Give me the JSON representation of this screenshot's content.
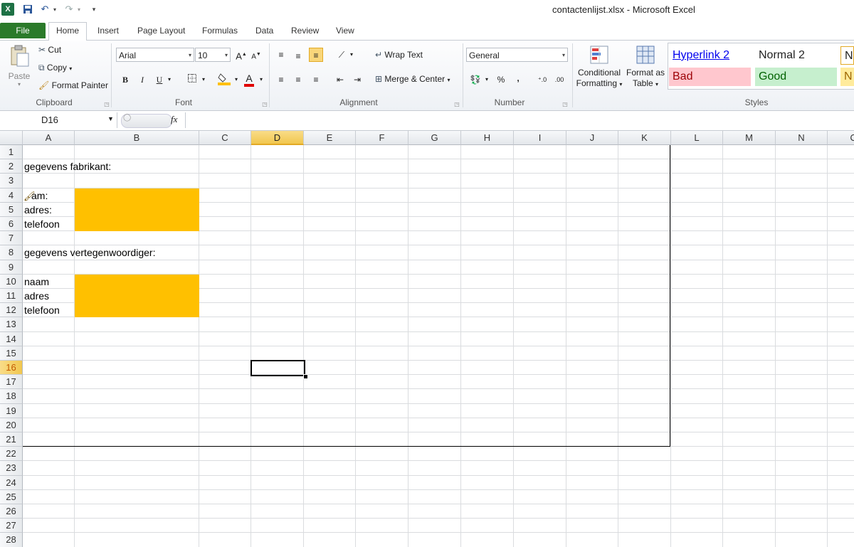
{
  "window": {
    "title": "contactenlijst.xlsx  -  Microsoft Excel"
  },
  "quick_access": {
    "save": "save-icon",
    "undo": "undo-icon",
    "redo": "redo-icon",
    "customize": "customize-icon"
  },
  "tabs": [
    {
      "label": "File"
    },
    {
      "label": "Home"
    },
    {
      "label": "Insert"
    },
    {
      "label": "Page Layout"
    },
    {
      "label": "Formulas"
    },
    {
      "label": "Data"
    },
    {
      "label": "Review"
    },
    {
      "label": "View"
    }
  ],
  "ribbon": {
    "clipboard": {
      "paste": "Paste",
      "cut": "Cut",
      "copy": "Copy",
      "format_painter": "Format Painter",
      "label": "Clipboard"
    },
    "font": {
      "name": "Arial",
      "size": "10",
      "bold": "B",
      "italic": "I",
      "underline": "U",
      "font_color_letter": "A",
      "grow": "A",
      "shrink": "A",
      "label": "Font"
    },
    "alignment": {
      "wrap_text": "Wrap Text",
      "merge_center": "Merge & Center",
      "label": "Alignment"
    },
    "number": {
      "format": "General",
      "percent": "%",
      "comma": ",",
      "label": "Number"
    },
    "styles": {
      "conditional": "Conditional",
      "conditional2": "Formatting",
      "format_table": "Format as",
      "format_table2": "Table",
      "label": "Styles",
      "cells": {
        "hyperlink2": "Hyperlink 2",
        "normal2": "Normal 2",
        "bad": "Bad",
        "good": "Good",
        "n_partial": "No",
        "n_partial2": "N"
      }
    }
  },
  "formula_bar": {
    "name_box": "D16",
    "fx": "fx",
    "content": ""
  },
  "sheet": {
    "columns": [
      "A",
      "B",
      "C",
      "D",
      "E",
      "F",
      "G",
      "H",
      "I",
      "J",
      "K",
      "L",
      "M",
      "N",
      "O"
    ],
    "rows": [
      "1",
      "2",
      "3",
      "4",
      "5",
      "6",
      "7",
      "8",
      "9",
      "10",
      "11",
      "12",
      "13",
      "14",
      "15",
      "16",
      "17",
      "18",
      "19",
      "20",
      "21",
      "22",
      "23",
      "24",
      "25",
      "26",
      "27",
      "28"
    ],
    "selected_cell": "D16",
    "cells": {
      "A2": "gegevens fabrikant:",
      "A4": "am:",
      "A5": "adres:",
      "A6": "telefoon",
      "A8": "gegevens vertegenwoordiger:",
      "A10": "naam",
      "A11": "adres",
      "A12": "telefoon"
    },
    "fill_color": "#ffc000"
  }
}
